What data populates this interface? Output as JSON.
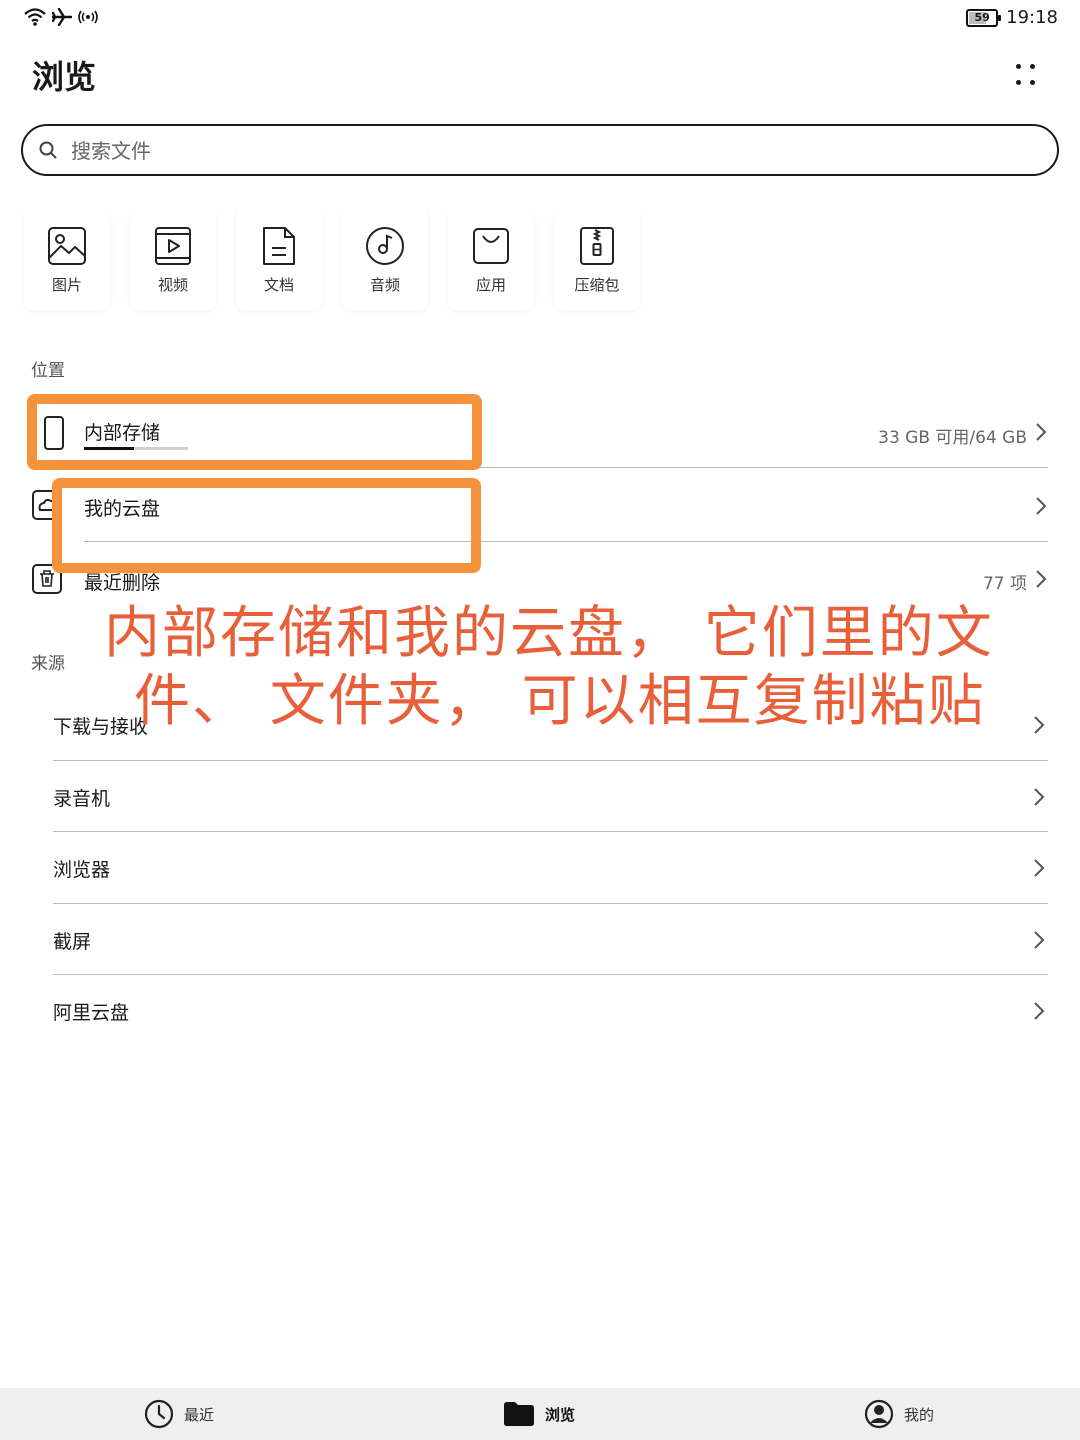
{
  "status_bar": {
    "time": "19:18",
    "battery_level": "59",
    "battery_fraction": 0.59
  },
  "header": {
    "title": "浏览"
  },
  "search": {
    "placeholder": "搜索文件"
  },
  "categories": [
    {
      "label": "图片",
      "icon": "image-icon"
    },
    {
      "label": "视频",
      "icon": "video-icon"
    },
    {
      "label": "文档",
      "icon": "document-icon"
    },
    {
      "label": "音频",
      "icon": "audio-icon"
    },
    {
      "label": "应用",
      "icon": "app-icon"
    },
    {
      "label": "压缩包",
      "icon": "archive-icon"
    }
  ],
  "locations": {
    "header": "位置",
    "items": [
      {
        "label": "内部存储",
        "value": "33 GB 可用/64 GB",
        "icon": "phone-storage-icon",
        "usage_fraction": 0.48
      },
      {
        "label": "我的云盘",
        "value": "",
        "icon": "cloud-drive-icon"
      },
      {
        "label": "最近删除",
        "value": "77 项",
        "icon": "trash-icon"
      }
    ]
  },
  "sources": {
    "header": "来源",
    "items": [
      {
        "label": "下载与接收"
      },
      {
        "label": "录音机"
      },
      {
        "label": "浏览器"
      },
      {
        "label": "截屏"
      },
      {
        "label": "阿里云盘"
      }
    ]
  },
  "annotation": {
    "line1": "内部存储和我的云盘，  它们里的文",
    "line2": "件、  文件夹，  可以相互复制粘贴",
    "color": "#e8603a",
    "box_color": "#f5923c"
  },
  "bottom_nav": {
    "items": [
      {
        "label": "最近",
        "icon": "clock-icon",
        "active": false
      },
      {
        "label": "浏览",
        "icon": "folder-icon",
        "active": true
      },
      {
        "label": "我的",
        "icon": "user-icon",
        "active": false
      }
    ]
  }
}
